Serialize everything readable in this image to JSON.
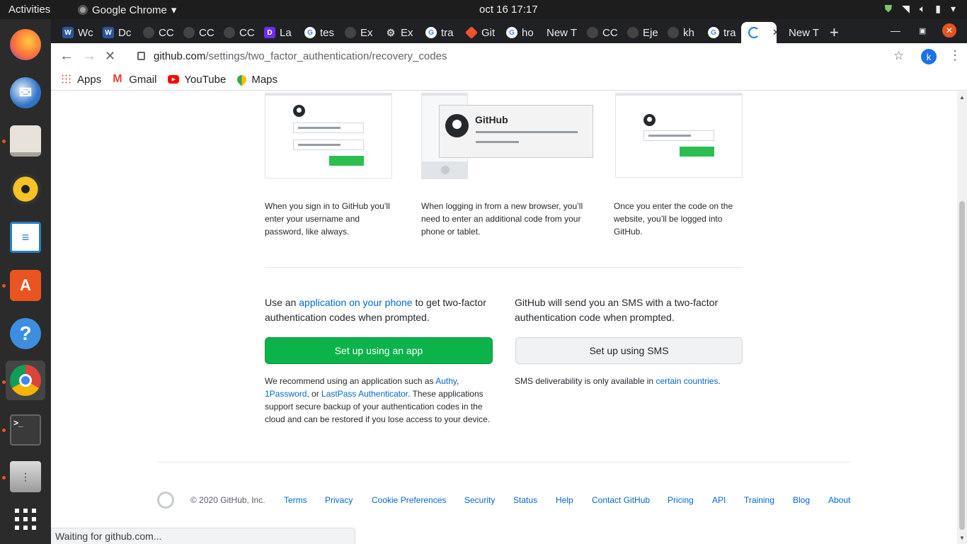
{
  "system": {
    "activities": "Activities",
    "app_name": "Google Chrome",
    "clock": "oct 16  17:17"
  },
  "tabs": [
    {
      "label": "Wc",
      "favicon": "word-icon",
      "color": "#2b579a"
    },
    {
      "label": "Dc",
      "favicon": "word-icon",
      "color": "#2b579a"
    },
    {
      "label": "CC",
      "favicon": "github-icon",
      "color": "#444"
    },
    {
      "label": "CC",
      "favicon": "github-icon",
      "color": "#444"
    },
    {
      "label": "CC",
      "favicon": "github-icon",
      "color": "#444"
    },
    {
      "label": "La",
      "favicon": "lab-icon",
      "color": "#6f2cf3"
    },
    {
      "label": "tes",
      "favicon": "google-icon",
      "color": "#4285f4"
    },
    {
      "label": "Ex",
      "favicon": "github-icon",
      "color": "#444"
    },
    {
      "label": "Ex",
      "favicon": "gear-icon",
      "color": "#888"
    },
    {
      "label": "tra",
      "favicon": "google-icon",
      "color": "#4285f4"
    },
    {
      "label": "Git",
      "favicon": "git-icon",
      "color": "#f05033"
    },
    {
      "label": "ho",
      "favicon": "google-icon",
      "color": "#4285f4"
    },
    {
      "label": "New T",
      "favicon": "",
      "color": ""
    },
    {
      "label": "CC",
      "favicon": "github-icon",
      "color": "#444"
    },
    {
      "label": "Eje",
      "favicon": "github-icon",
      "color": "#444"
    },
    {
      "label": "kh",
      "favicon": "github-icon",
      "color": "#444"
    },
    {
      "label": "tra",
      "favicon": "google-icon",
      "color": "#4285f4"
    },
    {
      "label": "",
      "favicon": "loading-icon",
      "color": "#1a73e8"
    },
    {
      "label": "New T",
      "favicon": "",
      "color": ""
    }
  ],
  "address": {
    "domain": "github.com",
    "path": "/settings/two_factor_authentication/recovery_codes"
  },
  "profile_initial": "k",
  "bookmarks": [
    {
      "label": "Apps"
    },
    {
      "label": "Gmail"
    },
    {
      "label": "YouTube"
    },
    {
      "label": "Maps"
    }
  ],
  "illustrations": {
    "phone_title": "GitHub"
  },
  "steps": [
    {
      "text": "When you sign in to GitHub you’ll enter your username and password, like always."
    },
    {
      "text": "When logging in from a new browser, you’ll need to enter an additional code from your phone or tablet."
    },
    {
      "text": "Once you enter the code on the website, you’ll be logged into GitHub."
    }
  ],
  "app_option": {
    "lead_before": "Use an ",
    "lead_link": "application on your phone",
    "lead_after": " to get two-factor authentication codes when prompted.",
    "button": "Set up using an app",
    "note_before": "We recommend using an application such as ",
    "note_link1": "Authy",
    "note_sep1": ", ",
    "note_link2": "1Password",
    "note_sep2": ", or ",
    "note_link3": "LastPass Authenticator",
    "note_after": ". These applications support secure backup of your authentication codes in the cloud and can be restored if you lose access to your device."
  },
  "sms_option": {
    "lead": "GitHub will send you an SMS with a two-factor authentication code when prompted.",
    "button": "Set up using SMS",
    "note_before": "SMS deliverability is only available in ",
    "note_link": "certain countries",
    "note_after": "."
  },
  "footer": {
    "copyright": "© 2020 GitHub, Inc.",
    "links": [
      "Terms",
      "Privacy",
      "Cookie Preferences",
      "Security",
      "Status",
      "Help",
      "Contact GitHub",
      "Pricing",
      "API",
      "Training",
      "Blog",
      "About"
    ]
  },
  "status": "Waiting for github.com..."
}
